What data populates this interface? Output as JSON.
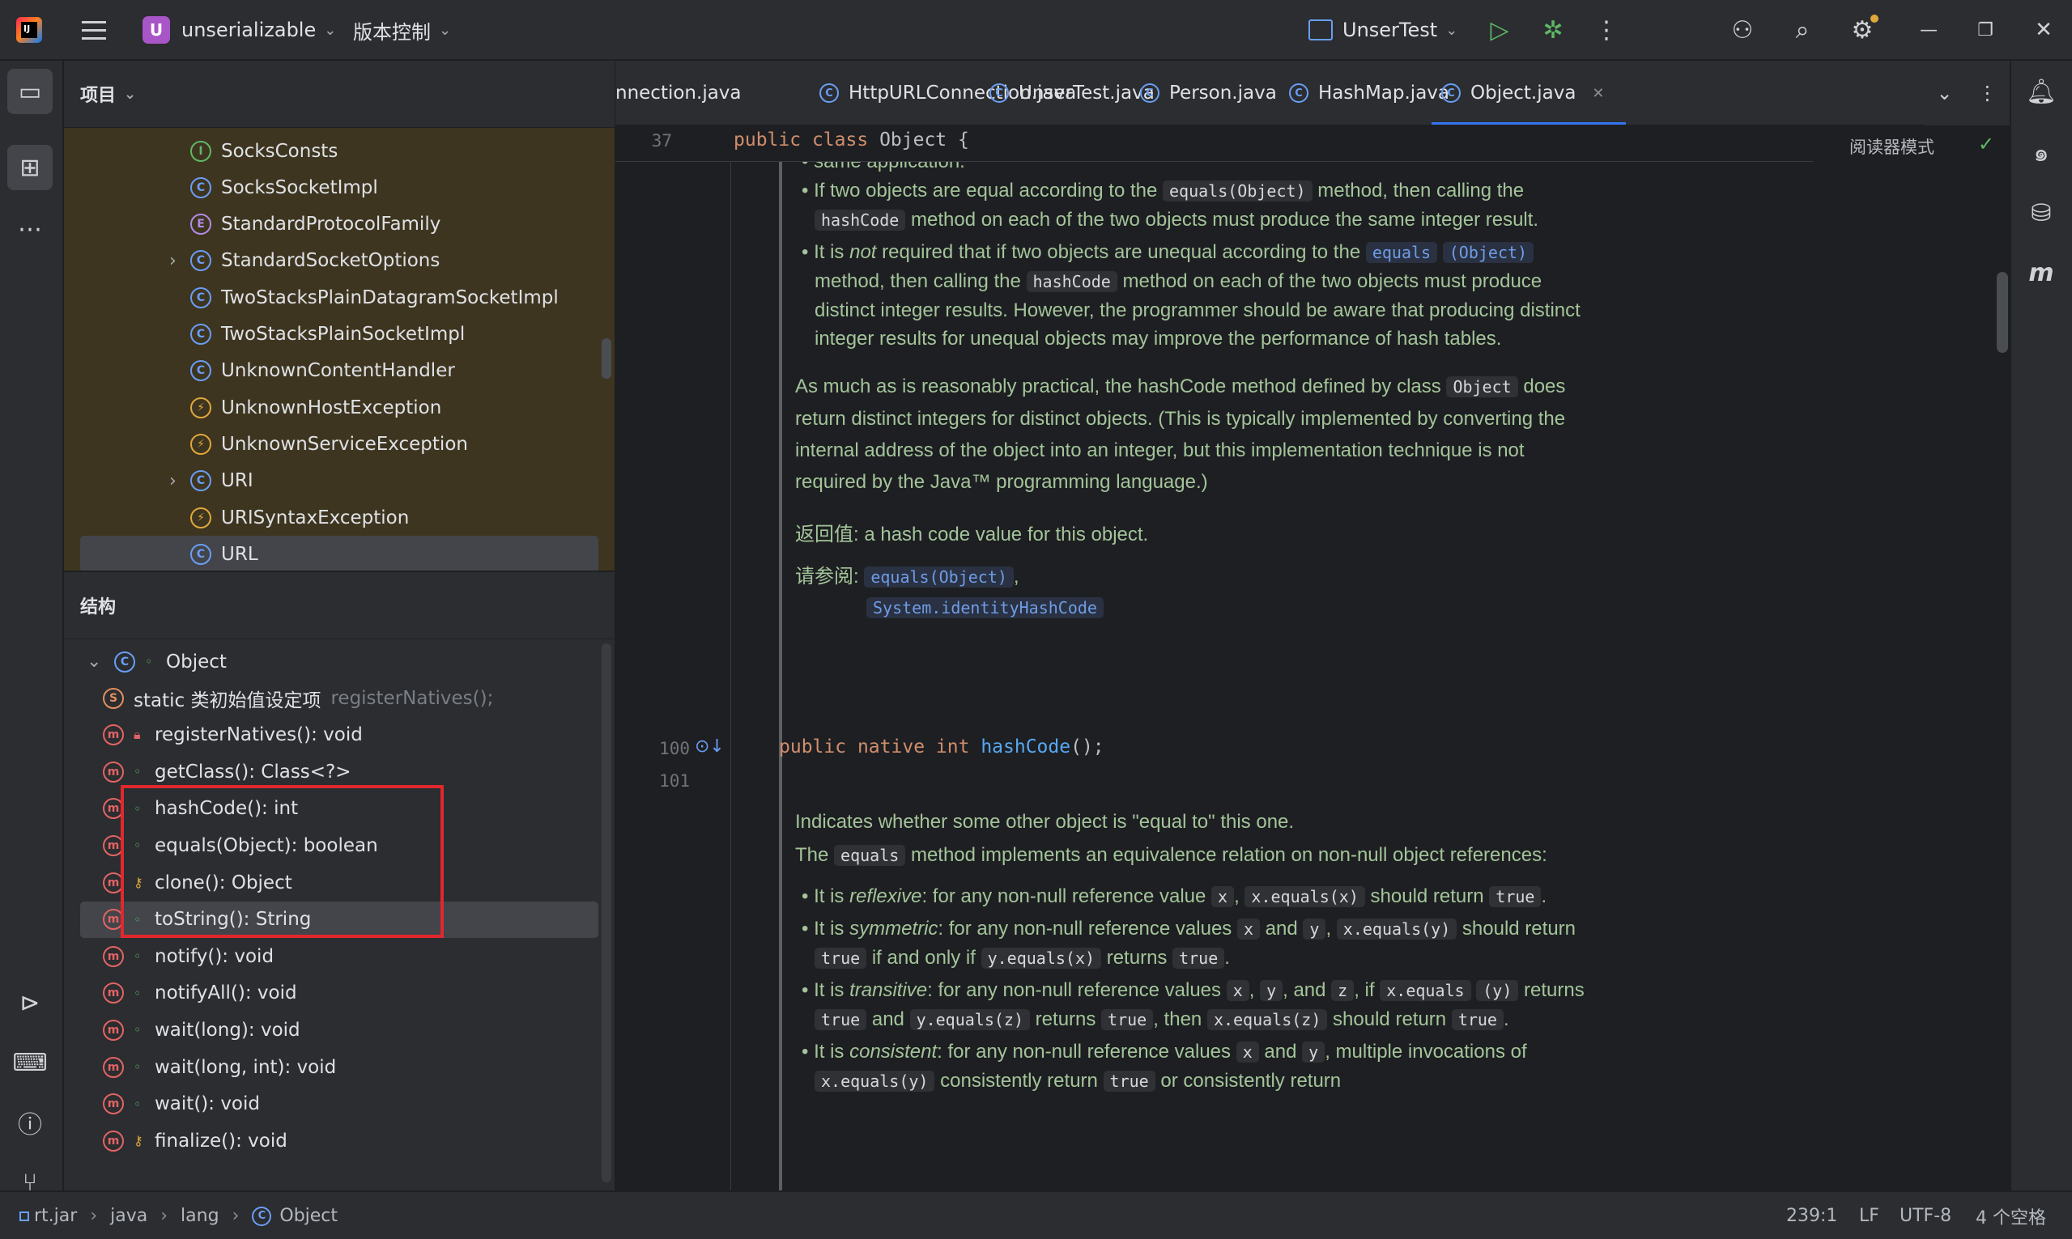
{
  "titlebar": {
    "project_badge": "U",
    "project_name": "unserializable",
    "vcs": "版本控制",
    "run_config": "UnserTest"
  },
  "icons": {
    "hamburger": "hamburger-menu-icon",
    "run": "run-icon",
    "debug": "debug-icon",
    "more": "more-vertical-icon",
    "account": "add-user-icon",
    "search": "search-icon",
    "settings": "settings-icon",
    "minimize": "minimize-icon",
    "restore": "restore-icon",
    "close": "close-icon"
  },
  "project_panel": {
    "title": "项目",
    "items": [
      {
        "label": "SocksConsts",
        "kind": "I",
        "expandable": false
      },
      {
        "label": "SocksSocketImpl",
        "kind": "C",
        "expandable": false
      },
      {
        "label": "StandardProtocolFamily",
        "kind": "E",
        "expandable": false
      },
      {
        "label": "StandardSocketOptions",
        "kind": "C",
        "expandable": true
      },
      {
        "label": "TwoStacksPlainDatagramSocketImpl",
        "kind": "C",
        "expandable": false
      },
      {
        "label": "TwoStacksPlainSocketImpl",
        "kind": "C",
        "expandable": false
      },
      {
        "label": "UnknownContentHandler",
        "kind": "C",
        "expandable": false
      },
      {
        "label": "UnknownHostException",
        "kind": "X",
        "expandable": false
      },
      {
        "label": "UnknownServiceException",
        "kind": "X",
        "expandable": false
      },
      {
        "label": "URI",
        "kind": "C",
        "expandable": true
      },
      {
        "label": "URISyntaxException",
        "kind": "X",
        "expandable": false
      },
      {
        "label": "URL",
        "kind": "C",
        "expandable": false
      }
    ]
  },
  "structure_panel": {
    "title": "结构",
    "root": "Object",
    "items": [
      {
        "label": "static 类初始值设定项",
        "hint": "registerNatives();",
        "vis": "none",
        "icon": "S"
      },
      {
        "label": "registerNatives(): void",
        "vis": "lock",
        "icon": "m"
      },
      {
        "label": "getClass(): Class<?>",
        "vis": "pub",
        "icon": "m"
      },
      {
        "label": "hashCode(): int",
        "vis": "pub",
        "icon": "m"
      },
      {
        "label": "equals(Object): boolean",
        "vis": "pub",
        "icon": "m"
      },
      {
        "label": "clone(): Object",
        "vis": "key",
        "icon": "m"
      },
      {
        "label": "toString(): String",
        "vis": "pub",
        "icon": "m"
      },
      {
        "label": "notify(): void",
        "vis": "pub",
        "icon": "m"
      },
      {
        "label": "notifyAll(): void",
        "vis": "pub",
        "icon": "m"
      },
      {
        "label": "wait(long): void",
        "vis": "pub",
        "icon": "m"
      },
      {
        "label": "wait(long, int): void",
        "vis": "pub",
        "icon": "m"
      },
      {
        "label": "wait(): void",
        "vis": "pub",
        "icon": "m"
      },
      {
        "label": "finalize(): void",
        "vis": "key",
        "icon": "m"
      }
    ]
  },
  "tabs": [
    {
      "label": "nnection.java",
      "icon": false
    },
    {
      "label": "HttpURLConnection.java",
      "icon": true
    },
    {
      "label": "UnserTest.java",
      "icon": true
    },
    {
      "label": "Person.java",
      "icon": true
    },
    {
      "label": "HashMap.java",
      "icon": true
    },
    {
      "label": "Object.java",
      "icon": true,
      "active": true
    }
  ],
  "editor": {
    "sticky_line": "37",
    "sticky_kw1": "public",
    "sticky_kw2": "class",
    "sticky_name": "Object {",
    "reader_mode": "阅读器模式",
    "line_100": "100",
    "line_101": "101",
    "code_kw1": "public",
    "code_kw2": "native",
    "code_kw3": "int",
    "code_fn": "hashCode",
    "code_rest": "();",
    "doc1": {
      "top_cut": "same application.",
      "b1_a": "If two objects are equal according to the ",
      "b1_code": "equals(Object)",
      "b1_b": " method, then calling the ",
      "b1_code2": "hashCode",
      "b1_c": " method on each of the two objects must produce the same integer result.",
      "b2_a": "It is ",
      "b2_not": "not",
      "b2_b": " required that if two objects are unequal according to the ",
      "b2_link": "equals",
      "b2_link2": "(Object)",
      "b2_c": " method, then calling the ",
      "b2_code": "hashCode",
      "b2_d": " method on each of the two objects must produce distinct integer results. However, the programmer should be aware that producing distinct integer results for unequal objects may improve the performance of hash tables.",
      "p1_a": "As much as is reasonably practical, the hashCode method defined by class ",
      "p1_code": "Object",
      "p1_b": " does return distinct integers for distinct objects. (This is typically implemented by converting the internal address of the object into an integer, but this implementation technique is not required by the Java™ programming language.)",
      "returns": "返回值: a hash code value for this object.",
      "see_label": "请参阅:",
      "see1": "equals(Object)",
      "see2": "System.identityHashCode"
    },
    "doc2": {
      "p1": "Indicates whether some other object is \"equal to\" this one.",
      "p2_a": "The ",
      "p2_code": "equals",
      "p2_b": " method implements an equivalence relation on non-null object references:",
      "b1_a": "It is ",
      "b1_i": "reflexive",
      "b1_b": ": for any non-null reference value ",
      "b1_c1": "x",
      "b1_c": ", ",
      "b1_c2": "x.equals(x)",
      "b1_d": " should return ",
      "b1_c3": "true",
      "b1_e": ".",
      "b2_a": "It is ",
      "b2_i": "symmetric",
      "b2_b": ": for any non-null reference values ",
      "b2_c1": "x",
      "b2_and": " and ",
      "b2_c2": "y",
      "b2_c": ", ",
      "b2_c3": "x.equals(y)",
      "b2_d": " should return ",
      "b2_c4": "true",
      "b2_e": " if and only if ",
      "b2_c5": "y.equals(x)",
      "b2_f": " returns ",
      "b2_c6": "true",
      "b2_g": ".",
      "b3_a": "It is ",
      "b3_i": "transitive",
      "b3_b": ": for any non-null reference values ",
      "b3_c1": "x",
      "b3_sep": ", ",
      "b3_c2": "y",
      "b3_and": ", and ",
      "b3_c3": "z",
      "b3_if": ", if ",
      "b3_c4": "x.equals",
      "b3_c5": "(y)",
      "b3_ret": " returns ",
      "b3_c6": "true",
      "b3_and2": " and ",
      "b3_c7": "y.equals(z)",
      "b3_ret2": " returns ",
      "b3_c8": "true",
      "b3_then": ", then ",
      "b3_c9": "x.equals(z)",
      "b3_should": " should return ",
      "b3_c10": "true",
      "b3_end": ".",
      "b4_a": "It is ",
      "b4_i": "consistent",
      "b4_b": ": for any non-null reference values ",
      "b4_c1": "x",
      "b4_and": " and ",
      "b4_c2": "y",
      "b4_c": ", multiple invocations of ",
      "b4_c3": "x.equals(y)",
      "b4_d": " consistently return ",
      "b4_c4": "true",
      "b4_e": " or consistently return"
    }
  },
  "statusbar": {
    "crumbs": [
      "rt.jar",
      "java",
      "lang",
      "Object"
    ],
    "position": "239:1",
    "line_sep": "LF",
    "encoding": "UTF-8",
    "indent": "4 个空格"
  }
}
